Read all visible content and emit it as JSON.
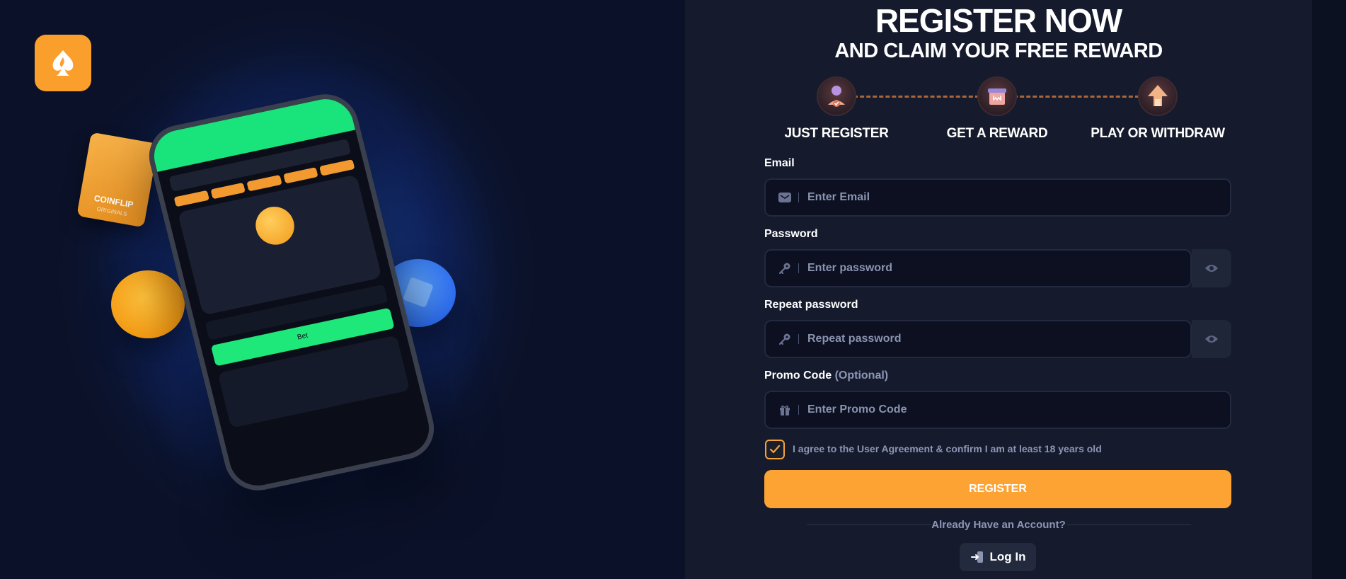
{
  "hero": {
    "logo_icon": "spade-flame-icon",
    "card": {
      "title": "COINFLIP",
      "subtitle": "ORIGINALS"
    },
    "phone": {
      "bet_label": "Bet"
    }
  },
  "register": {
    "title": "REGISTER NOW",
    "subtitle": "AND CLAIM YOUR FREE REWARD",
    "steps": [
      {
        "label": "JUST REGISTER",
        "icon": "user-check-icon"
      },
      {
        "label": "GET A REWARD",
        "icon": "gift-icon"
      },
      {
        "label": "PLAY OR WITHDRAW",
        "icon": "arrow-up-icon"
      }
    ],
    "email": {
      "label": "Email",
      "placeholder": "Enter Email",
      "icon": "envelope-icon"
    },
    "password": {
      "label": "Password",
      "placeholder": "Enter password",
      "icon": "key-icon"
    },
    "repeat_password": {
      "label": "Repeat password",
      "placeholder": "Repeat password",
      "icon": "key-icon"
    },
    "promo": {
      "label": "Promo Code",
      "optional": "(Optional)",
      "placeholder": "Enter Promo Code",
      "icon": "gift-icon"
    },
    "agreement": {
      "text": "I agree to the User Agreement & confirm I am at least 18 years old",
      "checked": true
    },
    "submit_label": "REGISTER",
    "already_text": "Already Have an Account?",
    "login_label": "Log In"
  },
  "colors": {
    "accent": "#fca333",
    "panel_bg": "#151b2d",
    "input_bg": "#0c1020",
    "phone_green": "#19e37b"
  }
}
